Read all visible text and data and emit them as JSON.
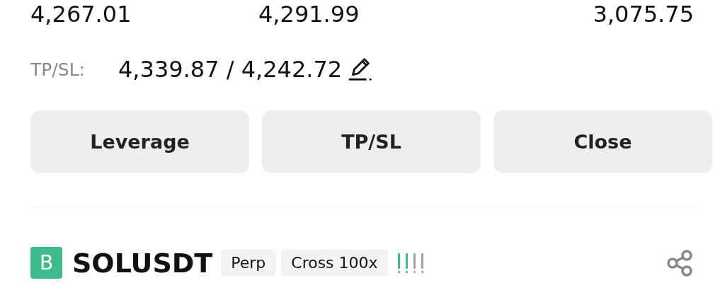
{
  "prices": [
    "4,267.01",
    "4,291.99",
    "3,075.75"
  ],
  "tpsl": {
    "label": "TP/SL:",
    "value": "4,339.87 / 4,242.72"
  },
  "buttons": [
    "Leverage",
    "TP/SL",
    "Close"
  ],
  "position": {
    "side": "B",
    "symbol": "SOLUSDT",
    "tags": [
      "Perp",
      "Cross 100x"
    ],
    "risk_meter": {
      "level": 0.5
    }
  }
}
